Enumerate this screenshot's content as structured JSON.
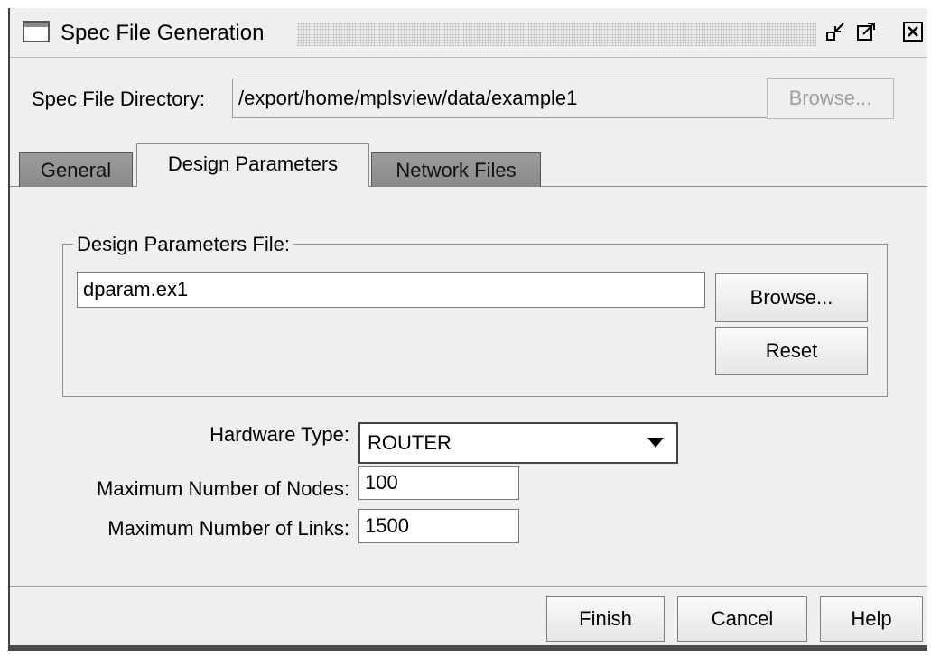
{
  "window": {
    "title": "Spec File Generation",
    "controls": [
      "minimize-icon",
      "maximize-icon",
      "close-icon"
    ]
  },
  "directory": {
    "label": "Spec File Directory:",
    "value": "/export/home/mplsview/data/example1",
    "browse_label": "Browse..."
  },
  "tabs": [
    {
      "label": "General",
      "active": false
    },
    {
      "label": "Design Parameters",
      "active": true
    },
    {
      "label": "Network Files",
      "active": false
    }
  ],
  "design_params": {
    "group_title": "Design Parameters File:",
    "file_value": "dparam.ex1",
    "browse_label": "Browse...",
    "reset_label": "Reset"
  },
  "form": {
    "hardware_label": "Hardware Type:",
    "hardware_value": "ROUTER",
    "max_nodes_label": "Maximum Number of Nodes:",
    "max_nodes_value": "100",
    "max_links_label": "Maximum Number of Links:",
    "max_links_value": "1500"
  },
  "footer": {
    "finish_label": "Finish",
    "cancel_label": "Cancel",
    "help_label": "Help"
  }
}
